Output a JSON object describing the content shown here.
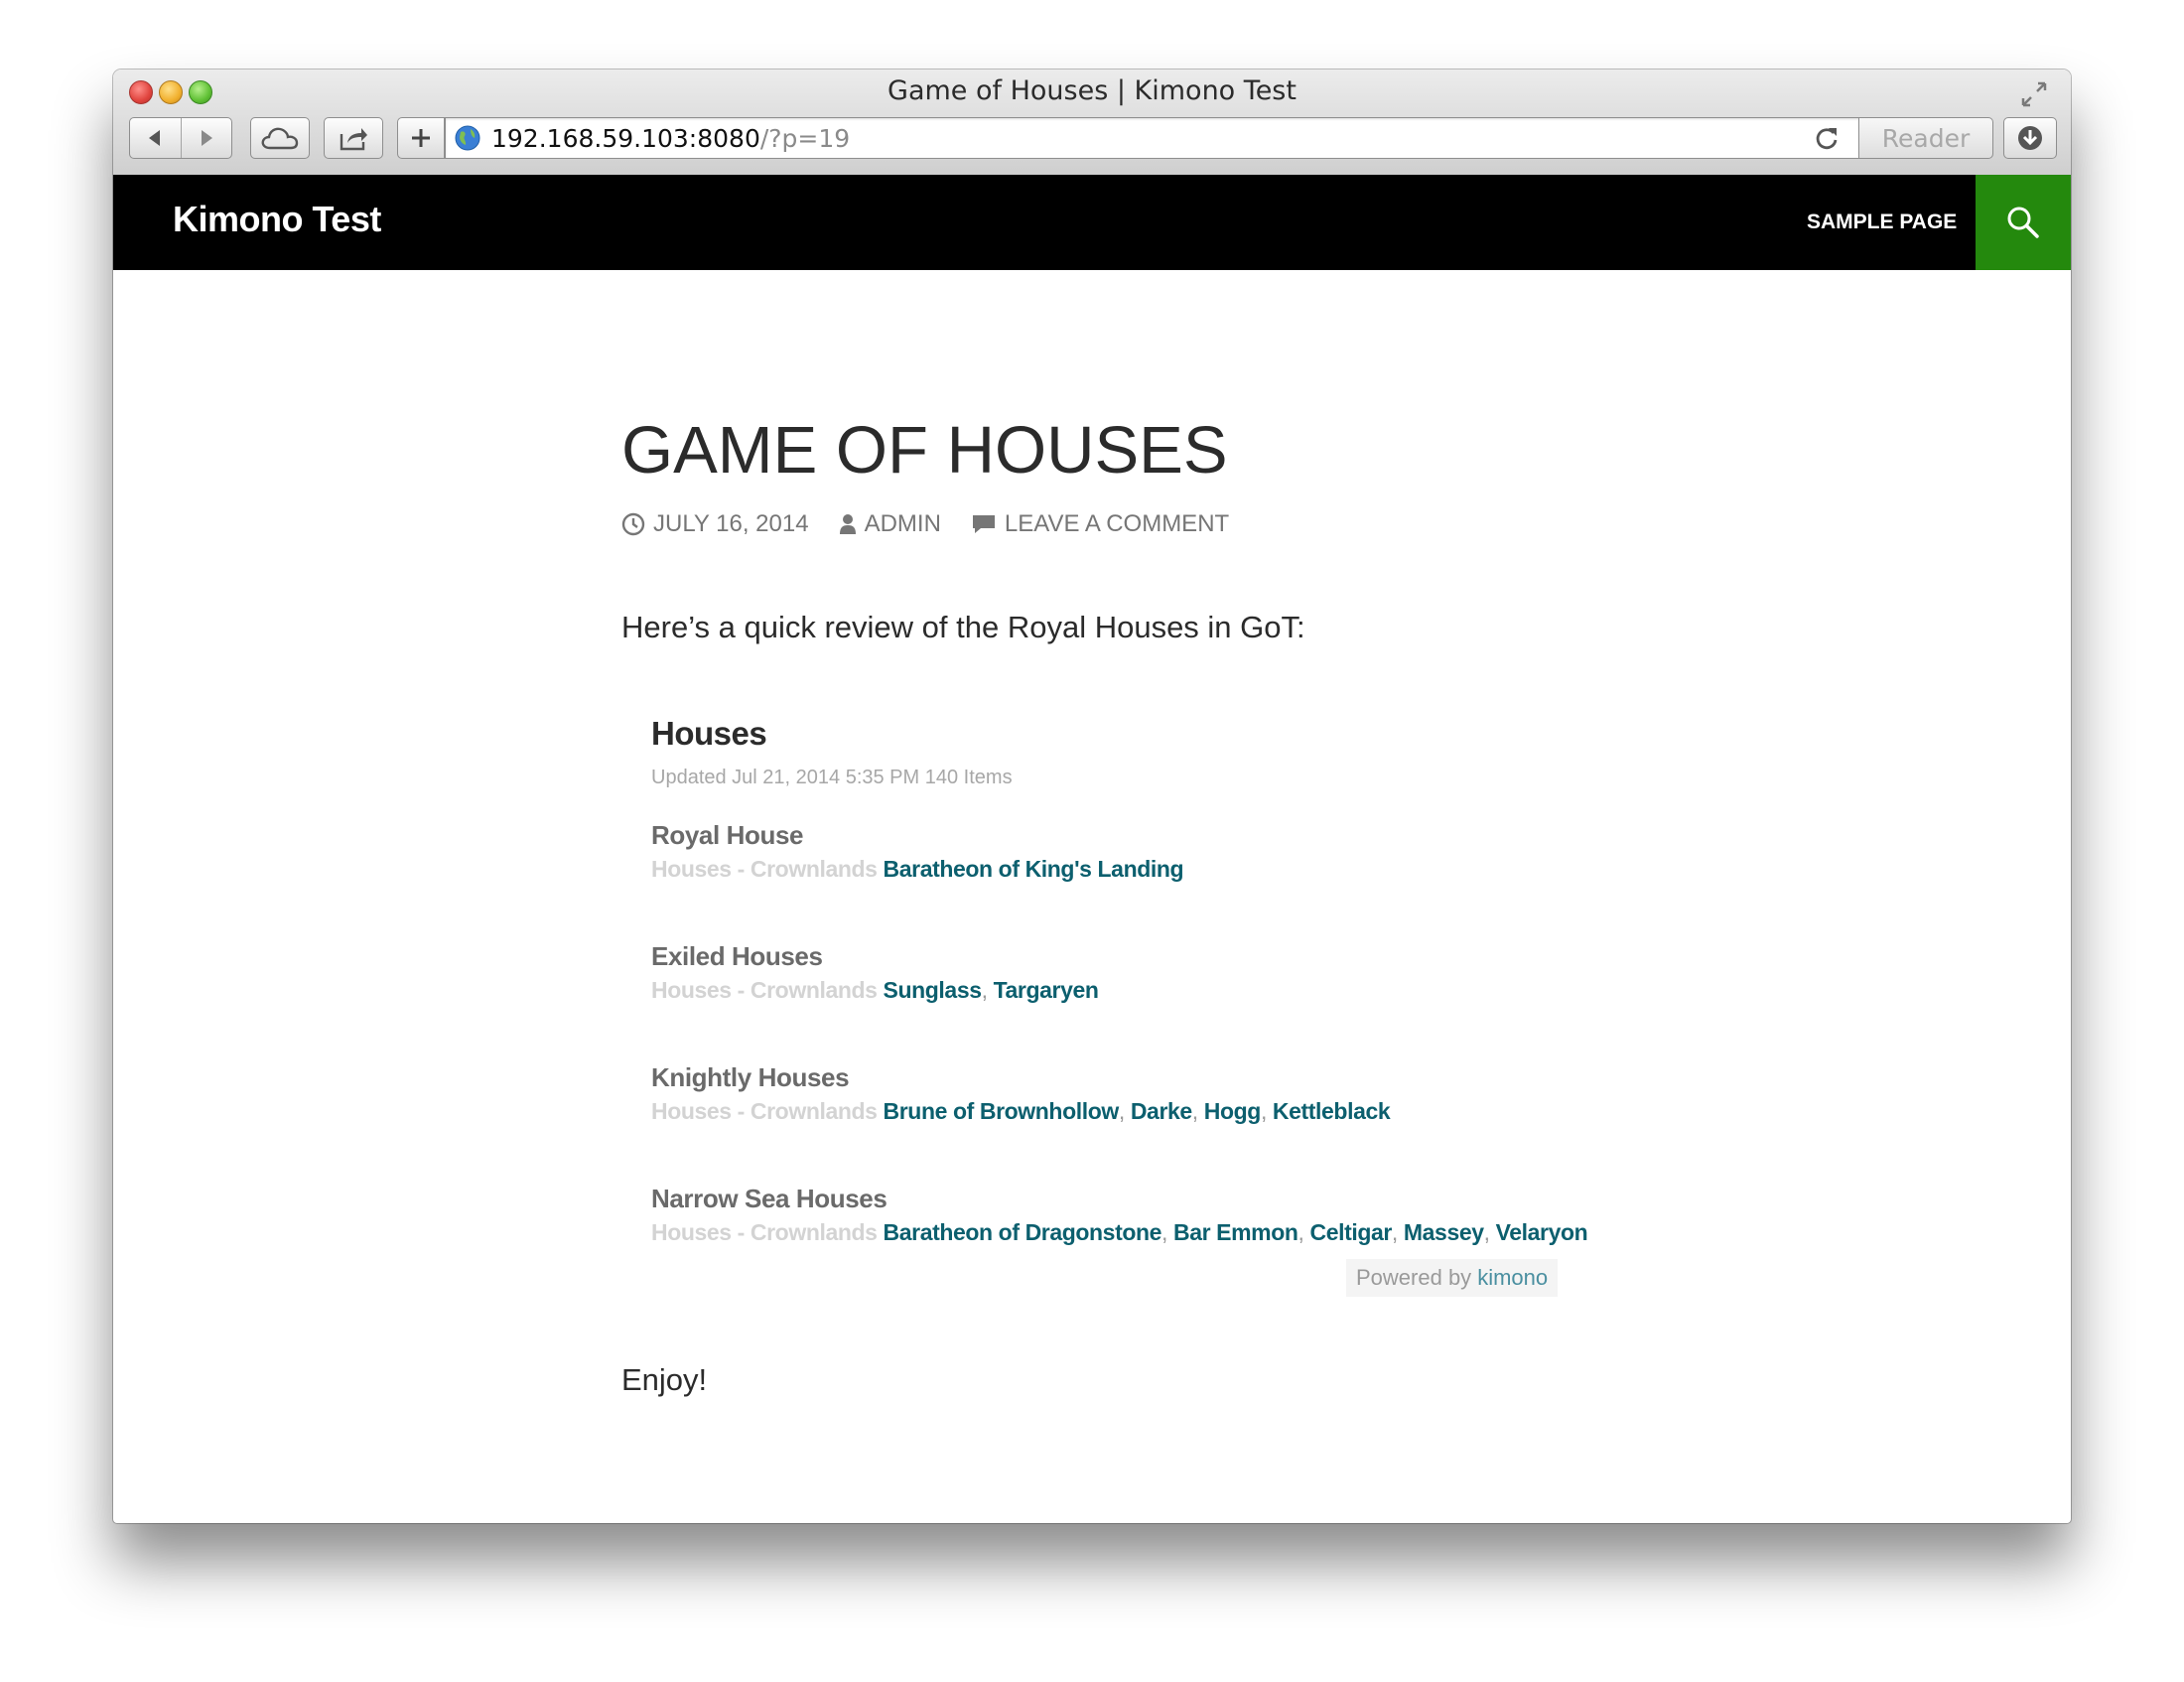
{
  "browser": {
    "window_title": "Game of Houses | Kimono Test",
    "url_host": "192.168.59.103:8080",
    "url_path": "/?p=19",
    "reader_label": "Reader"
  },
  "site": {
    "title": "Kimono Test",
    "nav_items": [
      "SAMPLE PAGE"
    ],
    "accent_color": "#24890d"
  },
  "post": {
    "title": "GAME OF HOUSES",
    "date": "JULY 16, 2014",
    "author": "ADMIN",
    "comment_link": "LEAVE A COMMENT",
    "intro": "Here’s a quick review of the Royal Houses in GoT:",
    "outro": "Enjoy!"
  },
  "widget": {
    "title": "Houses",
    "updated": "Updated Jul 21, 2014 5:35 PM",
    "item_count": "140 Items",
    "groups": [
      {
        "title": "Royal House",
        "breadcrumb": "Houses - Crownlands",
        "links": [
          "Baratheon of King's Landing"
        ]
      },
      {
        "title": "Exiled Houses",
        "breadcrumb": "Houses - Crownlands",
        "links": [
          "Sunglass",
          "Targaryen"
        ]
      },
      {
        "title": "Knightly Houses",
        "breadcrumb": "Houses - Crownlands",
        "links": [
          "Brune of Brownhollow",
          "Darke",
          "Hogg",
          "Kettleblack"
        ]
      },
      {
        "title": "Narrow Sea Houses",
        "breadcrumb": "Houses - Crownlands",
        "links": [
          "Baratheon of Dragonstone",
          "Bar Emmon",
          "Celtigar",
          "Massey",
          "Velaryon"
        ]
      }
    ],
    "powered_prefix": "Powered by",
    "powered_brand": "kimono"
  }
}
